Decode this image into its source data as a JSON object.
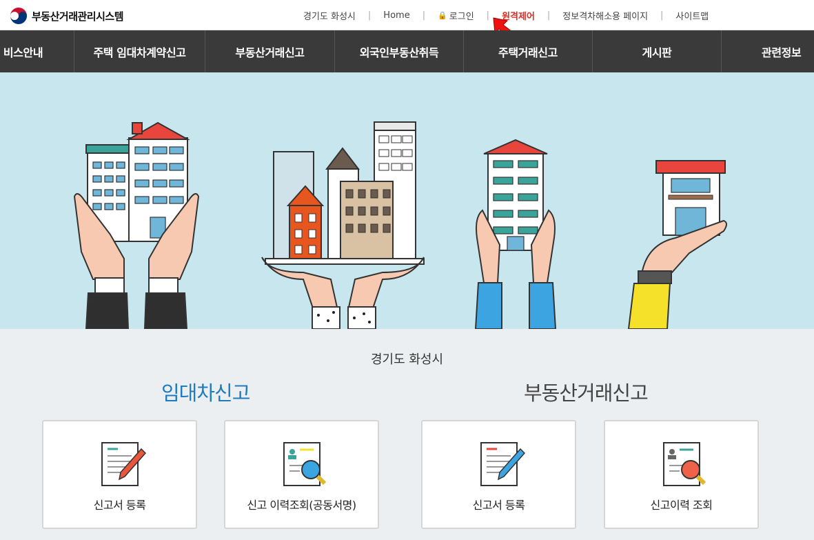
{
  "site": {
    "title": "부동산거래관리시스템"
  },
  "util_nav": {
    "region": "경기도 화성시",
    "home": "Home",
    "login": "로그인",
    "remote": "원격제어",
    "accessibility": "정보격차해소용 페이지",
    "sitemap": "사이트맵"
  },
  "gnb": {
    "items": [
      "비스안내",
      "주택 임대차계약신고",
      "부동산거래신고",
      "외국인부동산취득",
      "주택거래신고",
      "게시판",
      "관련정보"
    ]
  },
  "main": {
    "region_title": "경기도 화성시",
    "lease": {
      "title": "임대차신고",
      "cards": [
        {
          "label": "신고서 등록",
          "icon": "document-pencil-icon"
        },
        {
          "label": "신고 이력조회(공동서명)",
          "icon": "document-search-icon"
        }
      ]
    },
    "trade": {
      "title": "부동산거래신고",
      "cards": [
        {
          "label": "신고서 등록",
          "icon": "document-pencil-icon"
        },
        {
          "label": "신고이력 조회",
          "icon": "document-search-icon"
        }
      ]
    }
  },
  "colors": {
    "accent_blue": "#1e7bbd",
    "nav_bg": "#3a3a3a",
    "hero_bg": "#c8e6ee",
    "remote_red": "#e02b20"
  }
}
